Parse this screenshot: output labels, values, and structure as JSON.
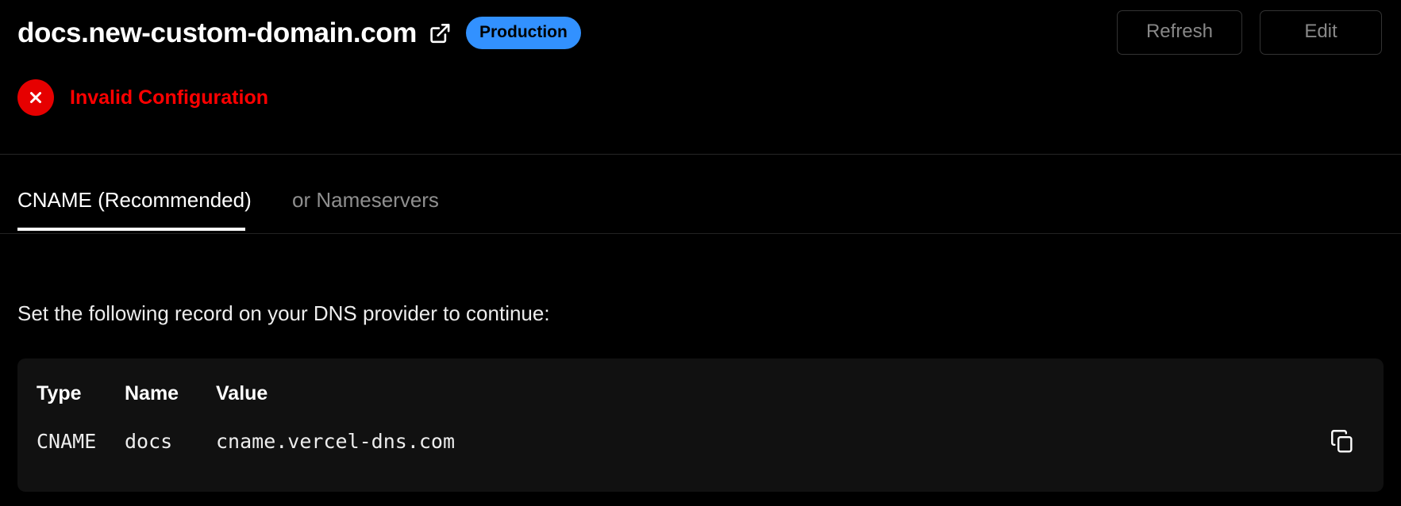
{
  "header": {
    "domain": "docs.new-custom-domain.com",
    "external_link_icon": "external-link-icon",
    "badge": "Production",
    "badge_color": "#3291ff",
    "actions": {
      "refresh_label": "Refresh",
      "edit_label": "Edit"
    }
  },
  "status": {
    "icon": "error-circle-x-icon",
    "text": "Invalid Configuration",
    "color": "#ff0000",
    "icon_background": "#e60000"
  },
  "tabs": [
    {
      "label": "CNAME (Recommended)",
      "active": true
    },
    {
      "label": "or Nameservers",
      "active": false
    }
  ],
  "main": {
    "instruction": "Set the following record on your DNS provider to continue:",
    "record_table": {
      "columns": [
        "Type",
        "Name",
        "Value"
      ],
      "rows": [
        {
          "type": "CNAME",
          "name": "docs",
          "value": "cname.vercel-dns.com",
          "copy_icon": "copy-icon"
        }
      ]
    }
  }
}
